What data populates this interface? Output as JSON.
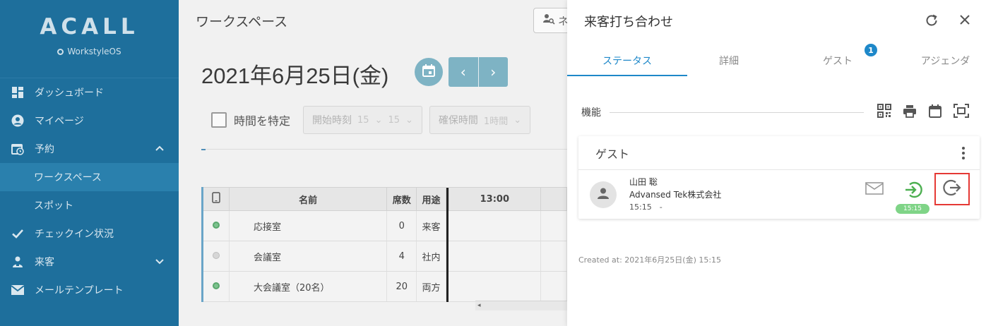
{
  "sidebar": {
    "logo": "ACALL",
    "sub_brand": "WorkstyleOS",
    "items": [
      {
        "label": "ダッシュボード"
      },
      {
        "label": "マイページ"
      },
      {
        "label": "予約"
      },
      {
        "label": "ワークスペース"
      },
      {
        "label": "スポット"
      },
      {
        "label": "チェックイン状況"
      },
      {
        "label": "来客"
      },
      {
        "label": "メールテンプレート"
      }
    ]
  },
  "main": {
    "page_title": "ワークスペース",
    "search_placeholder": "ネ",
    "date_title": "2021年6月25日(金)",
    "prev_label": "‹",
    "next_label": "›",
    "filters": {
      "specify_time_label": "時間を特定",
      "start_label": "開始時刻",
      "start_hour": "15",
      "start_min": "15",
      "duration_label": "確保時間",
      "duration_value": "1時間"
    },
    "table": {
      "headers": {
        "name": "名前",
        "seats": "席数",
        "usage": "用途",
        "time": "13:00"
      },
      "rows": [
        {
          "name": "応接室",
          "seats": "0",
          "usage": "来客",
          "status": "green"
        },
        {
          "name": "会議室",
          "seats": "4",
          "usage": "社内",
          "status": "gray"
        },
        {
          "name": "大会議室（20名）",
          "seats": "20",
          "usage": "両方",
          "status": "green"
        }
      ]
    }
  },
  "panel": {
    "title": "来客打ち合わせ",
    "tabs": [
      {
        "label": "ステータス"
      },
      {
        "label": "詳細"
      },
      {
        "label": "ゲスト"
      },
      {
        "label": "アジェンダ"
      }
    ],
    "guest_badge": "1",
    "function_label": "機能",
    "card_title": "ゲスト",
    "guest": {
      "name": "山田 聡",
      "company": "Advansed Tek株式会社",
      "time": "15:15　-",
      "checkin_time": "15:15"
    },
    "created_at": "Created at: 2021年6月25日(金) 15:15"
  },
  "colors": {
    "sidebar_bg": "#1e6f9c",
    "accent_blue": "#1e88c9",
    "checkin_green": "#4caf50",
    "highlight_red": "#e53935"
  }
}
